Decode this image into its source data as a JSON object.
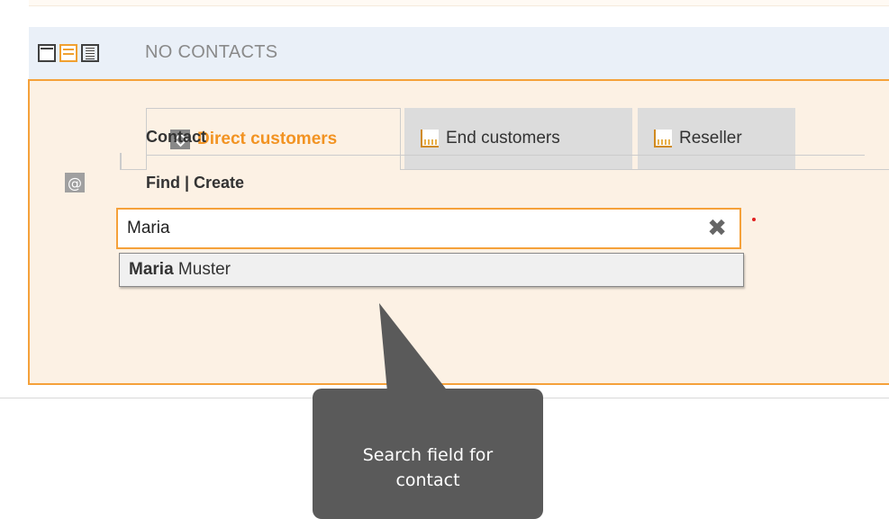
{
  "header": {
    "title": "NO CONTACTS",
    "view_icons": [
      "view-compact-icon",
      "view-card-icon",
      "view-list-icon"
    ]
  },
  "tabs": [
    {
      "label": "Direct customers",
      "icon": "diamond-icon",
      "active": true
    },
    {
      "label": "End customers",
      "icon": "factory-icon",
      "active": false
    },
    {
      "label": "Reseller",
      "icon": "factory-icon",
      "active": false
    }
  ],
  "form": {
    "section_label": "Contact",
    "field_label": "Find | Create",
    "field_icon": "at-icon",
    "search_value": "Maria",
    "required": true
  },
  "suggestions": [
    {
      "match": "Maria",
      "rest": " Muster"
    }
  ],
  "tooltip": {
    "text_line1": "Search field for",
    "text_line2": "contact"
  },
  "colors": {
    "accent": "#f5a13a",
    "active_tab_text": "#f29322",
    "panel_bg": "#fcf1e4",
    "header_bg": "#eaf0f8",
    "tooltip_bg": "#5a5a5a"
  }
}
